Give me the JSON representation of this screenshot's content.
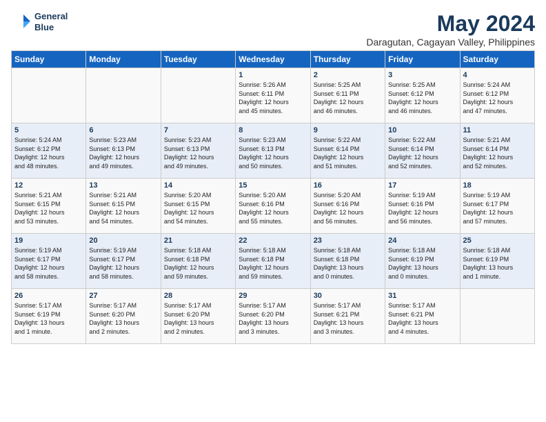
{
  "header": {
    "logo_line1": "General",
    "logo_line2": "Blue",
    "month_year": "May 2024",
    "location": "Daragutan, Cagayan Valley, Philippines"
  },
  "weekdays": [
    "Sunday",
    "Monday",
    "Tuesday",
    "Wednesday",
    "Thursday",
    "Friday",
    "Saturday"
  ],
  "weeks": [
    [
      {
        "day": "",
        "text": ""
      },
      {
        "day": "",
        "text": ""
      },
      {
        "day": "",
        "text": ""
      },
      {
        "day": "1",
        "text": "Sunrise: 5:26 AM\nSunset: 6:11 PM\nDaylight: 12 hours\nand 45 minutes."
      },
      {
        "day": "2",
        "text": "Sunrise: 5:25 AM\nSunset: 6:11 PM\nDaylight: 12 hours\nand 46 minutes."
      },
      {
        "day": "3",
        "text": "Sunrise: 5:25 AM\nSunset: 6:12 PM\nDaylight: 12 hours\nand 46 minutes."
      },
      {
        "day": "4",
        "text": "Sunrise: 5:24 AM\nSunset: 6:12 PM\nDaylight: 12 hours\nand 47 minutes."
      }
    ],
    [
      {
        "day": "5",
        "text": "Sunrise: 5:24 AM\nSunset: 6:12 PM\nDaylight: 12 hours\nand 48 minutes."
      },
      {
        "day": "6",
        "text": "Sunrise: 5:23 AM\nSunset: 6:13 PM\nDaylight: 12 hours\nand 49 minutes."
      },
      {
        "day": "7",
        "text": "Sunrise: 5:23 AM\nSunset: 6:13 PM\nDaylight: 12 hours\nand 49 minutes."
      },
      {
        "day": "8",
        "text": "Sunrise: 5:23 AM\nSunset: 6:13 PM\nDaylight: 12 hours\nand 50 minutes."
      },
      {
        "day": "9",
        "text": "Sunrise: 5:22 AM\nSunset: 6:14 PM\nDaylight: 12 hours\nand 51 minutes."
      },
      {
        "day": "10",
        "text": "Sunrise: 5:22 AM\nSunset: 6:14 PM\nDaylight: 12 hours\nand 52 minutes."
      },
      {
        "day": "11",
        "text": "Sunrise: 5:21 AM\nSunset: 6:14 PM\nDaylight: 12 hours\nand 52 minutes."
      }
    ],
    [
      {
        "day": "12",
        "text": "Sunrise: 5:21 AM\nSunset: 6:15 PM\nDaylight: 12 hours\nand 53 minutes."
      },
      {
        "day": "13",
        "text": "Sunrise: 5:21 AM\nSunset: 6:15 PM\nDaylight: 12 hours\nand 54 minutes."
      },
      {
        "day": "14",
        "text": "Sunrise: 5:20 AM\nSunset: 6:15 PM\nDaylight: 12 hours\nand 54 minutes."
      },
      {
        "day": "15",
        "text": "Sunrise: 5:20 AM\nSunset: 6:16 PM\nDaylight: 12 hours\nand 55 minutes."
      },
      {
        "day": "16",
        "text": "Sunrise: 5:20 AM\nSunset: 6:16 PM\nDaylight: 12 hours\nand 56 minutes."
      },
      {
        "day": "17",
        "text": "Sunrise: 5:19 AM\nSunset: 6:16 PM\nDaylight: 12 hours\nand 56 minutes."
      },
      {
        "day": "18",
        "text": "Sunrise: 5:19 AM\nSunset: 6:17 PM\nDaylight: 12 hours\nand 57 minutes."
      }
    ],
    [
      {
        "day": "19",
        "text": "Sunrise: 5:19 AM\nSunset: 6:17 PM\nDaylight: 12 hours\nand 58 minutes."
      },
      {
        "day": "20",
        "text": "Sunrise: 5:19 AM\nSunset: 6:17 PM\nDaylight: 12 hours\nand 58 minutes."
      },
      {
        "day": "21",
        "text": "Sunrise: 5:18 AM\nSunset: 6:18 PM\nDaylight: 12 hours\nand 59 minutes."
      },
      {
        "day": "22",
        "text": "Sunrise: 5:18 AM\nSunset: 6:18 PM\nDaylight: 12 hours\nand 59 minutes."
      },
      {
        "day": "23",
        "text": "Sunrise: 5:18 AM\nSunset: 6:18 PM\nDaylight: 13 hours\nand 0 minutes."
      },
      {
        "day": "24",
        "text": "Sunrise: 5:18 AM\nSunset: 6:19 PM\nDaylight: 13 hours\nand 0 minutes."
      },
      {
        "day": "25",
        "text": "Sunrise: 5:18 AM\nSunset: 6:19 PM\nDaylight: 13 hours\nand 1 minute."
      }
    ],
    [
      {
        "day": "26",
        "text": "Sunrise: 5:17 AM\nSunset: 6:19 PM\nDaylight: 13 hours\nand 1 minute."
      },
      {
        "day": "27",
        "text": "Sunrise: 5:17 AM\nSunset: 6:20 PM\nDaylight: 13 hours\nand 2 minutes."
      },
      {
        "day": "28",
        "text": "Sunrise: 5:17 AM\nSunset: 6:20 PM\nDaylight: 13 hours\nand 2 minutes."
      },
      {
        "day": "29",
        "text": "Sunrise: 5:17 AM\nSunset: 6:20 PM\nDaylight: 13 hours\nand 3 minutes."
      },
      {
        "day": "30",
        "text": "Sunrise: 5:17 AM\nSunset: 6:21 PM\nDaylight: 13 hours\nand 3 minutes."
      },
      {
        "day": "31",
        "text": "Sunrise: 5:17 AM\nSunset: 6:21 PM\nDaylight: 13 hours\nand 4 minutes."
      },
      {
        "day": "",
        "text": ""
      }
    ]
  ]
}
